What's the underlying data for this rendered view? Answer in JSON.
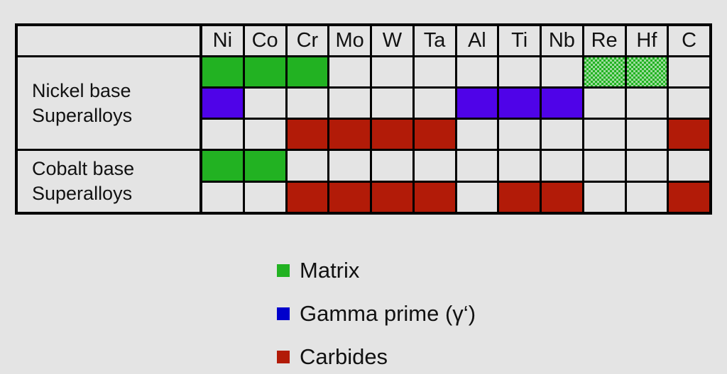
{
  "figure": {
    "background_color": "#e4e4e4",
    "colors": {
      "matrix_green": "#22b222",
      "gamma_prime_blue": "#4f03e8",
      "carbide_red": "#b21b08",
      "legend_blue": "#0000cc",
      "empty_cell": "#e4e4e4",
      "grid_line": "#000000"
    }
  },
  "table": {
    "corner_header": "",
    "columns": [
      "Ni",
      "Co",
      "Cr",
      "Mo",
      "W",
      "Ta",
      "Al",
      "Ti",
      "Nb",
      "Re",
      "Hf",
      "C"
    ],
    "groups": [
      {
        "label": "Nickel base\nSuperalloys",
        "label_line1": "Nickel base",
        "label_line2": "Superalloys",
        "rows": [
          {
            "phase": "Matrix",
            "fills": [
              "green",
              "green",
              "green",
              "none",
              "none",
              "none",
              "none",
              "none",
              "none",
              "green-dotted",
              "green-dotted",
              "none"
            ]
          },
          {
            "phase": "Gamma prime",
            "fills": [
              "blue",
              "none",
              "none",
              "none",
              "none",
              "none",
              "blue",
              "blue",
              "blue",
              "none",
              "none",
              "none"
            ]
          },
          {
            "phase": "Carbides",
            "fills": [
              "none",
              "none",
              "red",
              "red",
              "red",
              "red",
              "none",
              "none",
              "none",
              "none",
              "none",
              "red"
            ]
          }
        ]
      },
      {
        "label": "Cobalt base\nSuperalloys",
        "label_line1": "Cobalt base",
        "label_line2": "Superalloys",
        "rows": [
          {
            "phase": "Matrix",
            "fills": [
              "green",
              "green",
              "none",
              "none",
              "none",
              "none",
              "none",
              "none",
              "none",
              "none",
              "none",
              "none"
            ]
          },
          {
            "phase": "Carbides",
            "fills": [
              "none",
              "none",
              "red",
              "red",
              "red",
              "red",
              "none",
              "red",
              "red",
              "none",
              "none",
              "red"
            ]
          }
        ]
      }
    ]
  },
  "legend": {
    "items": [
      {
        "label": "Matrix",
        "color": "#22b222"
      },
      {
        "label": "Gamma prime (γ‘)",
        "color": "#0000cc"
      },
      {
        "label": "Carbides",
        "color": "#b21b08"
      }
    ]
  }
}
